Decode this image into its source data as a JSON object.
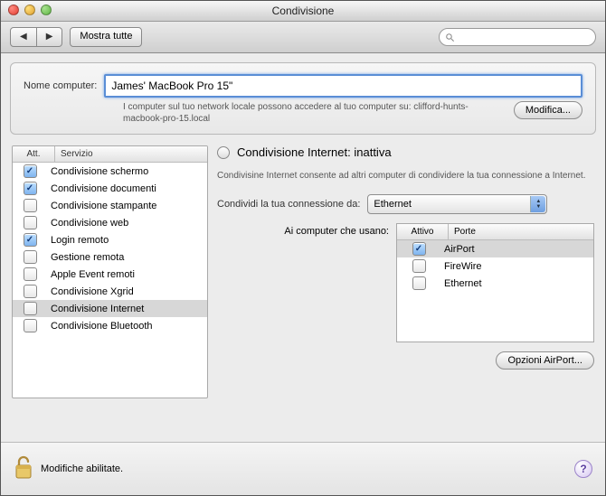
{
  "window": {
    "title": "Condivisione"
  },
  "toolbar": {
    "show_all": "Mostra tutte",
    "search_placeholder": ""
  },
  "computer_name": {
    "label": "Nome computer:",
    "value": "James' MacBook Pro 15\"",
    "subtext": "I computer sul tuo network locale possono accedere al tuo computer su: clifford-hunts-macbook-pro-15.local",
    "edit_button": "Modifica..."
  },
  "services": {
    "header_on": "Att.",
    "header_service": "Servizio",
    "items": [
      {
        "on": true,
        "label": "Condivisione schermo",
        "selected": false
      },
      {
        "on": true,
        "label": "Condivisione documenti",
        "selected": false
      },
      {
        "on": false,
        "label": "Condivisione stampante",
        "selected": false
      },
      {
        "on": false,
        "label": "Condivisione web",
        "selected": false
      },
      {
        "on": true,
        "label": "Login remoto",
        "selected": false
      },
      {
        "on": false,
        "label": "Gestione remota",
        "selected": false
      },
      {
        "on": false,
        "label": "Apple Event remoti",
        "selected": false
      },
      {
        "on": false,
        "label": "Condivisione Xgrid",
        "selected": false
      },
      {
        "on": false,
        "label": "Condivisione Internet",
        "selected": true
      },
      {
        "on": false,
        "label": "Condivisione Bluetooth",
        "selected": false
      }
    ]
  },
  "detail": {
    "status_title": "Condivisione Internet: inattiva",
    "description": "Condivisine Internet consente ad altri computer di condividere la tua connessione a Internet.",
    "share_from_label": "Condividi la tua connessione da:",
    "share_from_value": "Ethernet",
    "to_label": "Ai computer che usano:",
    "ports_header_on": "Attivo",
    "ports_header_ports": "Porte",
    "ports": [
      {
        "on": true,
        "label": "AirPort",
        "selected": true
      },
      {
        "on": false,
        "label": "FireWire",
        "selected": false
      },
      {
        "on": false,
        "label": "Ethernet",
        "selected": false
      }
    ],
    "options_button": "Opzioni AirPort..."
  },
  "footer": {
    "lock_text": "Modifiche abilitate."
  }
}
